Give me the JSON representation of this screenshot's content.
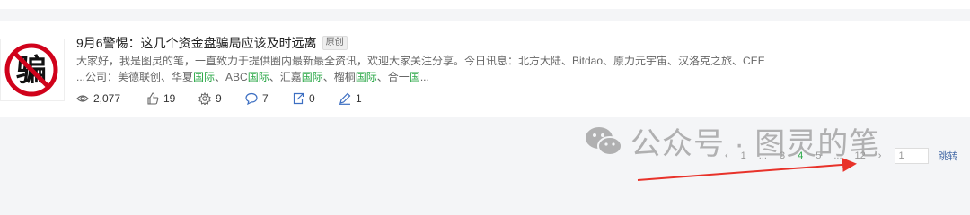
{
  "article": {
    "title": "9月6警惕：这几个资金盘骗局应该及时远离",
    "badge": "原创",
    "thumbnail_char": "骗",
    "summary_line1": "大家好，我是图灵的笔，一直致力于提供圈内最新最全资讯，欢迎大家关注分享。今日讯息：北方大陆、Bitdao、原力元宇宙、汉洛克之旅、CEE",
    "summary_line2": {
      "prefix": "...公司：美德联创、华夏",
      "s1": "国际",
      "m1": "、ABC",
      "s2": "国际",
      "m2": "、汇嘉",
      "s3": "国际",
      "m3": "、榴桐",
      "s4": "国际",
      "m4": "、合一",
      "s5": "国",
      "suffix": "..."
    },
    "stats": {
      "views": "2,077",
      "likes": "19",
      "shares": "9",
      "comments": "7",
      "forwards": "0",
      "edits": "1"
    }
  },
  "watermark": {
    "text": "公众号 · 图灵的笔",
    "icon": "wechat-icon"
  },
  "pagination": {
    "prev": "‹",
    "pages": [
      "1",
      "...",
      "3",
      "4",
      "5",
      "...",
      "12"
    ],
    "active": "4",
    "next": "›",
    "input_value": "1",
    "jump_label": "跳转"
  },
  "colors": {
    "accent_green": "#28a745",
    "annotation_arrow": "#e8322a",
    "link_blue": "#4a6ea9"
  }
}
